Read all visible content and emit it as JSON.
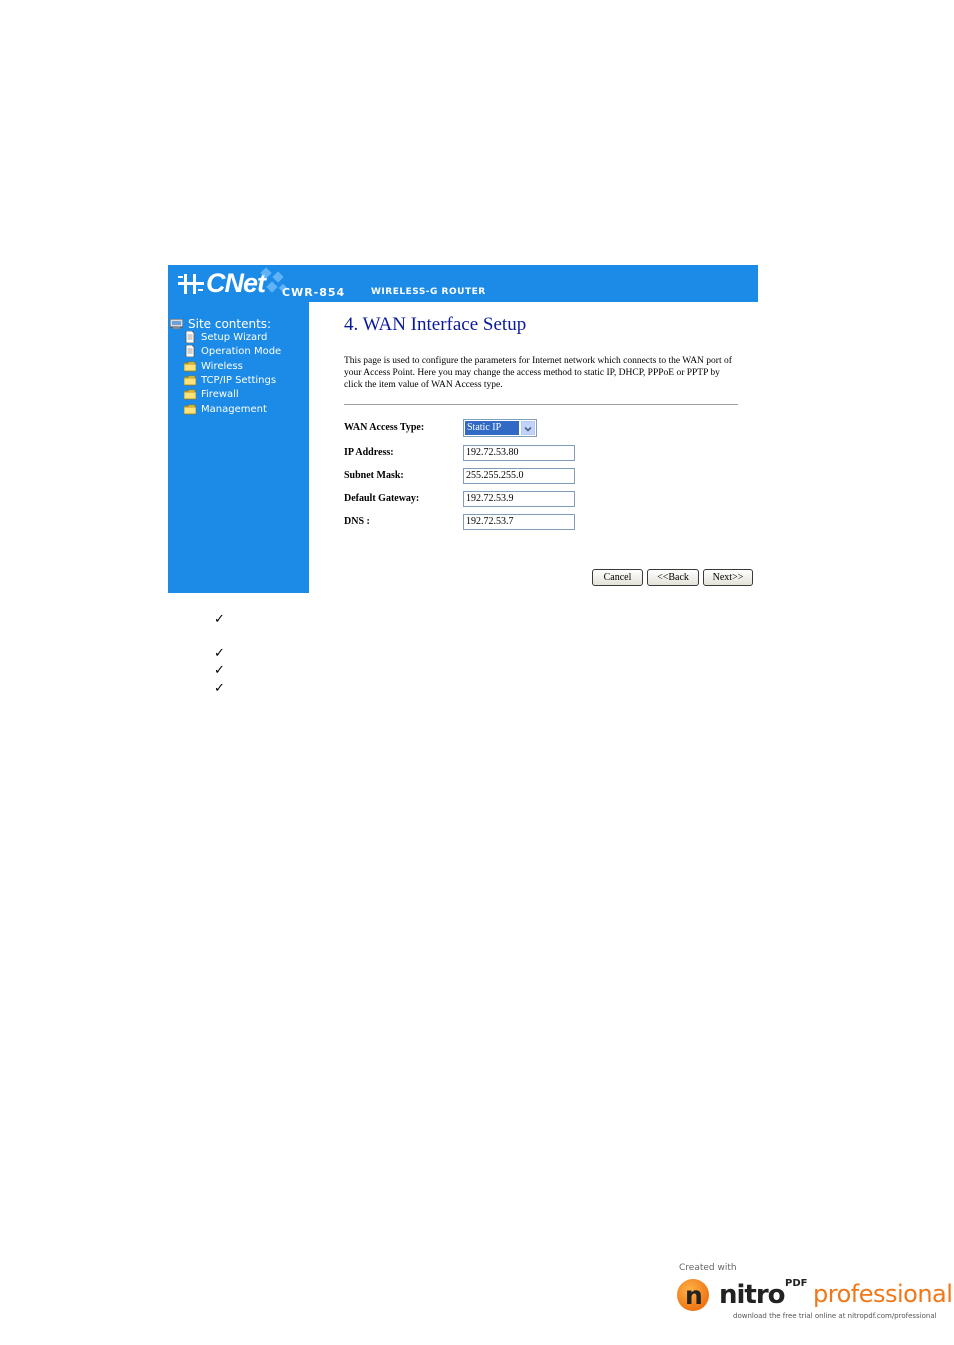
{
  "header": {
    "logo": "CNet",
    "model": "CWR-854",
    "product": "WIRELESS-G ROUTER",
    "brand_color": "#1c8be8"
  },
  "sidebar": {
    "root_label": "Site contents:",
    "items": [
      {
        "label": "Setup Wizard",
        "icon": "page-icon"
      },
      {
        "label": "Operation Mode",
        "icon": "page-icon"
      },
      {
        "label": "Wireless",
        "icon": "folder-icon"
      },
      {
        "label": "TCP/IP Settings",
        "icon": "folder-icon"
      },
      {
        "label": "Firewall",
        "icon": "folder-icon"
      },
      {
        "label": "Management",
        "icon": "folder-icon"
      }
    ]
  },
  "main": {
    "title": "4. WAN Interface Setup",
    "title_color": "#0b1a9a",
    "description": "This page is used to configure the parameters for Internet network which connects to the WAN port of your Access Point. Here you may change the access method to static IP, DHCP, PPPoE or PPTP by click the item value of WAN Access type.",
    "form": {
      "wan_access_type": {
        "label": "WAN Access Type:",
        "value": "Static IP"
      },
      "ip_address": {
        "label": "IP Address:",
        "value": "192.72.53.80"
      },
      "subnet_mask": {
        "label": "Subnet Mask:",
        "value": "255.255.255.0"
      },
      "default_gateway": {
        "label": "Default Gateway:",
        "value": "192.72.53.9"
      },
      "dns": {
        "label": "DNS :",
        "value": "192.72.53.7"
      }
    },
    "buttons": {
      "cancel": "Cancel",
      "back": "<<Back",
      "next": "Next>>"
    }
  },
  "checkmarks": [
    "✓",
    "✓",
    "✓",
    "✓"
  ],
  "footer": {
    "created_with": "Created with",
    "brand_word": "nitro",
    "brand_sup": "PDF",
    "brand_pro": "professional",
    "tagline": "download the free trial online at nitropdf.com/professional"
  }
}
